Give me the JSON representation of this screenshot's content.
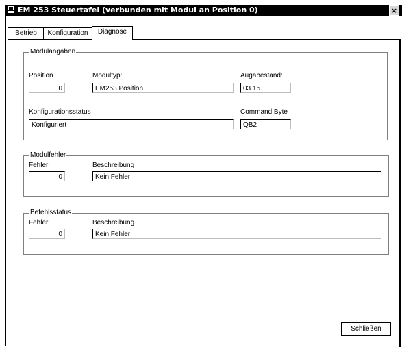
{
  "window": {
    "title": "EM 253 Steuertafel (verbunden mit Modul an Position 0)",
    "close_glyph": "×"
  },
  "tabs": [
    {
      "label": "Betrieb",
      "active": false
    },
    {
      "label": "Konfiguration",
      "active": false
    },
    {
      "label": "Diagnose",
      "active": true
    }
  ],
  "modulangaben": {
    "group_label": "Modulangaben",
    "position_label": "Position",
    "position_value": "0",
    "modultyp_label": "Modultyp:",
    "modultyp_value": "EM253 Position",
    "ausgabestand_label": "Augabestand:",
    "ausgabestand_value": "03.15",
    "konfigstatus_label": "Konfigurationsstatus",
    "konfigstatus_value": "Konfiguriert",
    "command_byte_label": "Command Byte",
    "command_byte_value": "QB2"
  },
  "modulfehler": {
    "group_label": "Modulfehler",
    "fehler_label": "Fehler",
    "fehler_value": "0",
    "beschreibung_label": "Beschreibung",
    "beschreibung_value": "Kein Fehler"
  },
  "befehlsstatus": {
    "group_label": "Befehlsstatus",
    "fehler_label": "Fehler",
    "fehler_value": "0",
    "beschreibung_label": "Beschreibung",
    "beschreibung_value": "Kein Fehler"
  },
  "buttons": {
    "close_label": "Schließen"
  }
}
